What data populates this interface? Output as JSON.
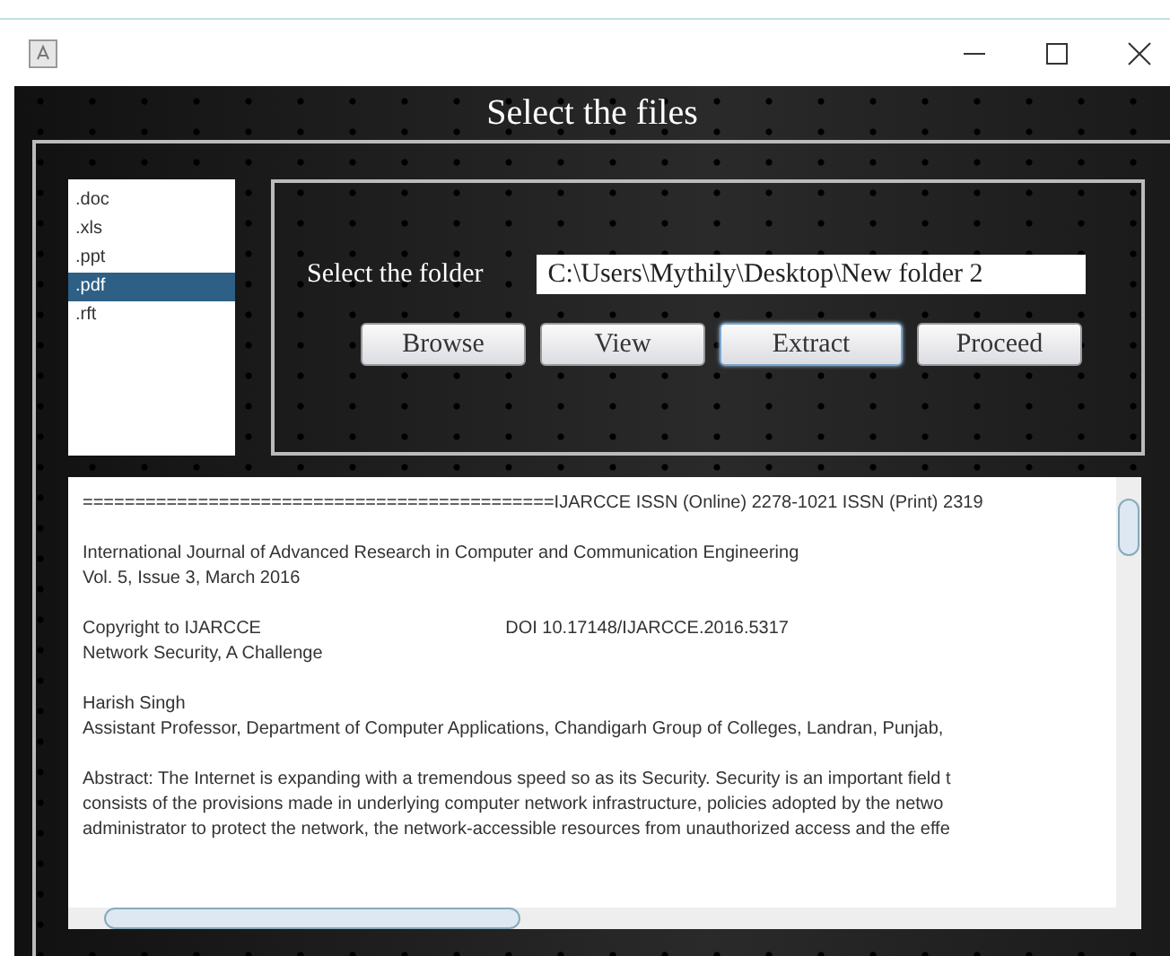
{
  "window": {
    "title": "Select the files"
  },
  "file_types": [
    {
      "label": ".doc",
      "selected": false
    },
    {
      "label": ".xls",
      "selected": false
    },
    {
      "label": ".ppt",
      "selected": false
    },
    {
      "label": ".pdf",
      "selected": true
    },
    {
      "label": ".rft",
      "selected": false
    }
  ],
  "folder": {
    "label": "Select the folder",
    "value": "C:\\Users\\Mythily\\Desktop\\New folder 2"
  },
  "buttons": [
    {
      "label": "Browse",
      "focused": false
    },
    {
      "label": "View",
      "focused": false
    },
    {
      "label": "Extract",
      "focused": true
    },
    {
      "label": "Proceed",
      "focused": false
    }
  ],
  "output_paragraphs": [
    [
      "=============================================IJARCCE ISSN (Online) 2278-1021 ISSN (Print) 2319"
    ],
    [
      "International Journal of Advanced Research in Computer and Communication Engineering",
      "Vol. 5, Issue 3, March 2016"
    ],
    [
      "Copyright to IJARCCE                                                 DOI 10.17148/IJARCCE.2016.5317",
      "Network Security, A Challenge"
    ],
    [
      "Harish Singh",
      "Assistant Professor, Department of Computer Applications, Chandigarh Group of Colleges, Landran, Punjab,"
    ],
    [
      "Abstract: The Internet is expanding with a tremendous speed so as its Security. Security is an important field t",
      "consists of the provisions made in underlying computer network infrastructure, policies adopted by the netwo",
      "administrator to protect the network, the network-accessible resources from unauthorized access and the effe"
    ]
  ]
}
